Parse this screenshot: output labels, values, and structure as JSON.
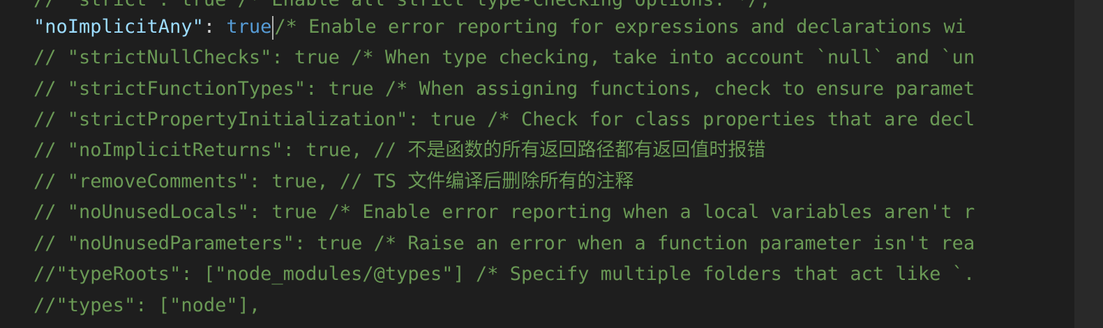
{
  "editor": {
    "lines": [
      {
        "seg": [
          {
            "t": "// \"strict\": true /* Enable all strict type-checking options. */,",
            "c": "comment"
          }
        ]
      },
      {
        "seg": [
          {
            "t": "\"noImplicitAny\"",
            "c": "key"
          },
          {
            "t": ": ",
            "c": "punc"
          },
          {
            "t": "true",
            "c": "kw"
          },
          {
            "t": "/* Enable error reporting for expressions and declarations wi",
            "c": "comment"
          }
        ]
      },
      {
        "seg": [
          {
            "t": "// \"strictNullChecks\": true /* When type checking, take into account `null` and `un",
            "c": "comment"
          }
        ]
      },
      {
        "seg": [
          {
            "t": "// \"strictFunctionTypes\": true /* When assigning functions, check to ensure paramet",
            "c": "comment"
          }
        ]
      },
      {
        "seg": [
          {
            "t": "// \"strictPropertyInitialization\": true /* Check for class properties that are decl",
            "c": "comment"
          }
        ]
      },
      {
        "seg": [
          {
            "t": "// \"noImplicitReturns\": true, // 不是函数的所有返回路径都有返回值时报错",
            "c": "comment"
          }
        ]
      },
      {
        "seg": [
          {
            "t": "// \"removeComments\": true, // TS 文件编译后删除所有的注释",
            "c": "comment"
          }
        ]
      },
      {
        "seg": [
          {
            "t": "// \"noUnusedLocals\": true /* Enable error reporting when a local variables aren't r",
            "c": "comment"
          }
        ]
      },
      {
        "seg": [
          {
            "t": "// \"noUnusedParameters\": true /* Raise an error when a function parameter isn't rea",
            "c": "comment"
          }
        ]
      },
      {
        "seg": [
          {
            "t": "//\"typeRoots\": [\"node_modules/@types\"] /* Specify multiple folders that act like `.",
            "c": "comment"
          }
        ]
      },
      {
        "seg": [
          {
            "t": "//\"types\": [\"node\"],",
            "c": "comment"
          }
        ]
      }
    ],
    "cursor_line": 1,
    "cursor_after_segment": 2
  },
  "colors": {
    "background": "#1e1e1e",
    "comment": "#6a9955",
    "key": "#9cdcfe",
    "keyword": "#569cd6",
    "text": "#d4d4d4"
  }
}
